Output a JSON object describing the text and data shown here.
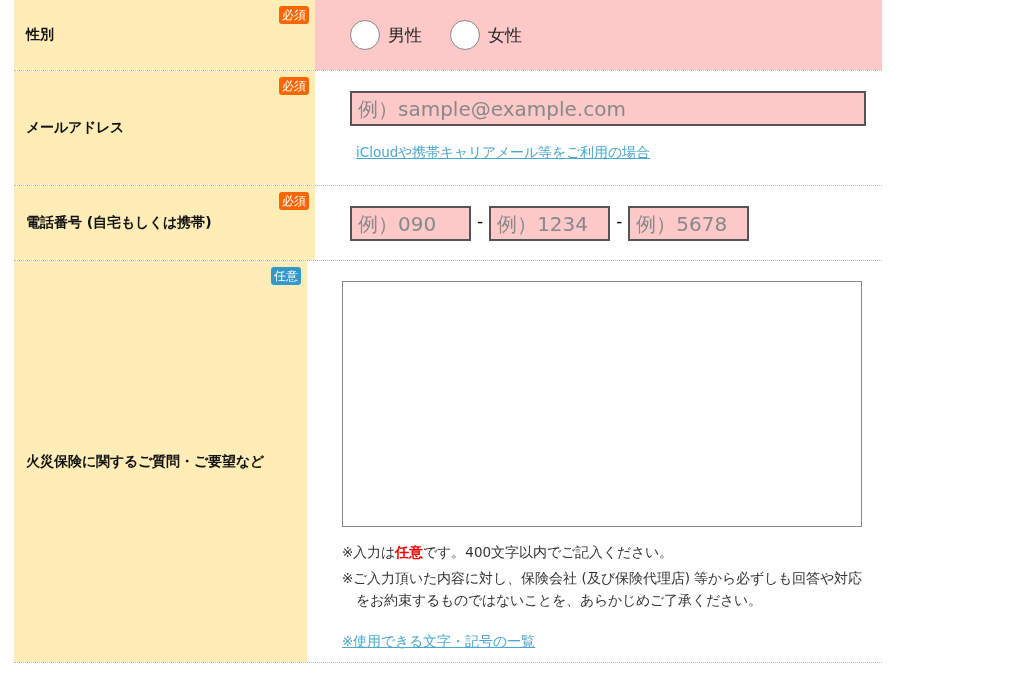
{
  "rows": [
    {
      "kind": "radio",
      "label": "性別",
      "badge": {
        "kind": "required",
        "text": "必須"
      },
      "invalid": true,
      "options": [
        {
          "label": "男性",
          "selected": false
        },
        {
          "label": "女性",
          "selected": false
        }
      ]
    },
    {
      "kind": "email",
      "label": "メールアドレス",
      "badge": {
        "kind": "required",
        "text": "必須"
      },
      "invalid": true,
      "placeholder": "例）sample@example.com",
      "link": "iCloudや携帯キャリアメール等をご利用の場合"
    },
    {
      "kind": "phone",
      "label": "電話番号 (自宅もしくは携帯)",
      "badge": {
        "kind": "required",
        "text": "必須"
      },
      "invalid": true,
      "separator": "-",
      "fields": [
        {
          "placeholder": "例）090"
        },
        {
          "placeholder": "例）1234"
        },
        {
          "placeholder": "例）5678"
        }
      ]
    },
    {
      "kind": "textarea",
      "label": "火災保険に関するご質問・ご要望など",
      "badge": {
        "kind": "optional",
        "text": "任意"
      },
      "invalid": false,
      "notes": [
        "※入力は**任意**です。400文字以内でご記入ください。",
        "※ご入力頂いた内容に対し、保険会社 (及び保険代理店) 等から必ずしも回答や対応をお約束するものではないことを、あらかじめご了承ください。"
      ],
      "link": "※使用できる文字・記号の一覧"
    }
  ]
}
